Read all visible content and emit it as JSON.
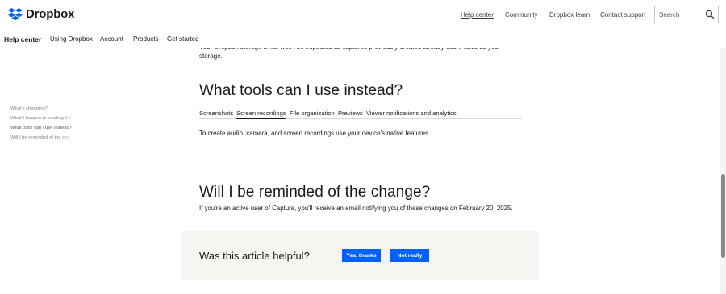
{
  "header": {
    "brand": "Dropbox",
    "nav": [
      {
        "label": "Help center",
        "active": true
      },
      {
        "label": "Community",
        "active": false
      },
      {
        "label": "Dropbox learn",
        "active": false
      },
      {
        "label": "Contact support",
        "active": false
      }
    ],
    "search": {
      "placeholder": "Search"
    }
  },
  "subnav": {
    "title": "Help center",
    "items": [
      "Using Dropbox",
      "Account",
      "Products",
      "Get started"
    ]
  },
  "toc": {
    "items": [
      {
        "label": "What's changing?",
        "current": false
      },
      {
        "label": "What'll happen to existing Ca",
        "current": false
      },
      {
        "label": "What tools can I use instead?",
        "current": true
      },
      {
        "label": "Will I be reminded of the cha",
        "current": false
      }
    ]
  },
  "article": {
    "cut_line": "Your Dropbox storage limits won't be impacted as captures previously created already count towards your",
    "top_paragraph": "storage.",
    "section1_heading": "What tools can I use instead?",
    "tabs": [
      {
        "label": "Screenshots",
        "active": false
      },
      {
        "label": "Screen recordings",
        "active": true
      },
      {
        "label": "File organization",
        "active": false
      },
      {
        "label": "Previews",
        "active": false
      },
      {
        "label": "Viewer notifications and analytics",
        "active": false
      }
    ],
    "tab_content": "To create audio, camera, and screen recordings use your device's native features.",
    "section2_heading": "Will I be reminded of the change?",
    "section2_text": "If you're an active user of Capture, you'll receive an email notifying you of these changes on February 20, 2025."
  },
  "feedback": {
    "question": "Was this article helpful?",
    "yes_label": "Yes, thanks",
    "no_label": "Not really"
  },
  "colors": {
    "accent": "#0061fe",
    "feedback_bg": "#f7f5f2",
    "text": "#1e1919"
  }
}
